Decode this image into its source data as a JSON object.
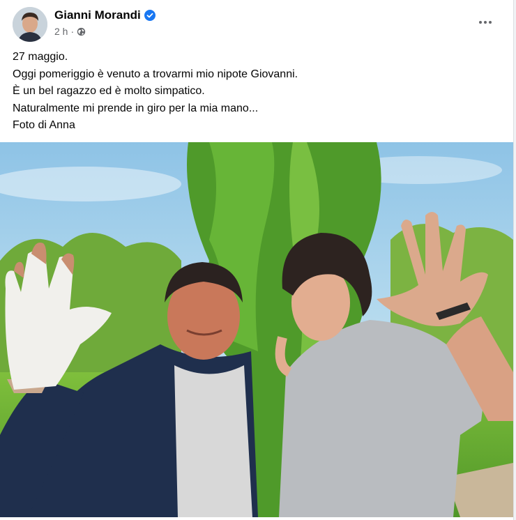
{
  "post": {
    "author": "Gianni Morandi",
    "timestamp": "2 h",
    "separator": "·",
    "privacy_icon": "globe-icon",
    "verified_icon": "verified-badge-icon",
    "more_icon": "more-options-icon",
    "lines": [
      "27 maggio.",
      "Oggi pomeriggio è venuto a trovarmi mio nipote Giovanni.",
      "È un bel ragazzo ed è molto simpatico.",
      "Naturalmente mi prende in giro per la mia mano...",
      "Foto di Anna"
    ]
  },
  "colors": {
    "verified": "#1877f2",
    "secondary_text": "#65676b",
    "primary_text": "#050505"
  }
}
